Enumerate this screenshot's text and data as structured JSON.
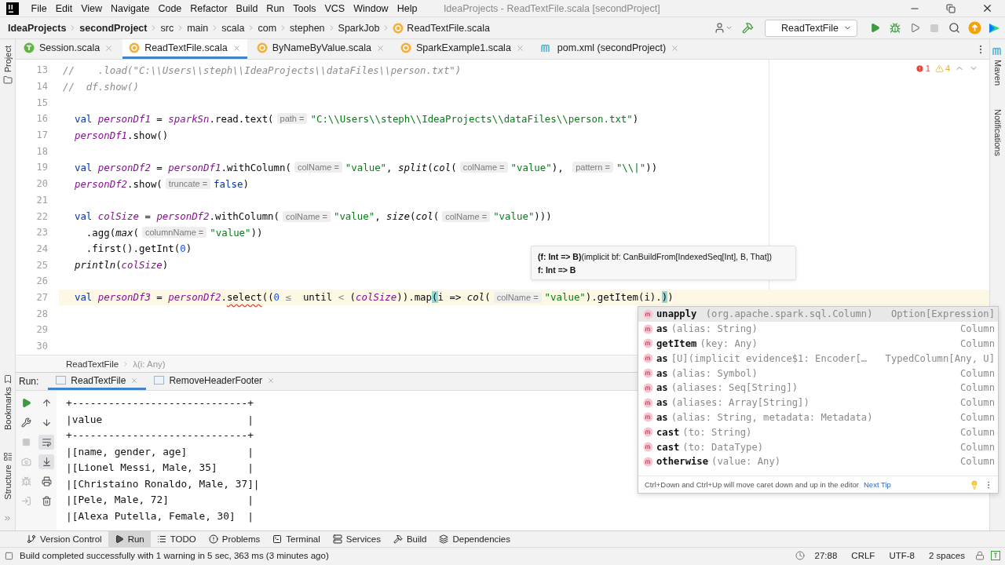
{
  "window": {
    "title": "IdeaProjects - ReadTextFile.scala [secondProject]"
  },
  "menu": [
    "File",
    "Edit",
    "View",
    "Navigate",
    "Code",
    "Refactor",
    "Build",
    "Run",
    "Tools",
    "VCS",
    "Window",
    "Help"
  ],
  "breadcrumb": [
    {
      "label": "IdeaProjects",
      "bold": true
    },
    {
      "label": "secondProject",
      "bold": true
    },
    {
      "label": "src",
      "bold": false
    },
    {
      "label": "main",
      "bold": false
    },
    {
      "label": "scala",
      "bold": false
    },
    {
      "label": "com",
      "bold": false
    },
    {
      "label": "stephen",
      "bold": false
    },
    {
      "label": "SparkJob",
      "bold": false
    },
    {
      "label": "ReadTextFile.scala",
      "bold": false,
      "kind": "object"
    }
  ],
  "toolbar": {
    "run_config": "ReadTextFile"
  },
  "editor_tabs": [
    {
      "label": "Session.scala",
      "kind": "trait",
      "selected": false
    },
    {
      "label": "ReadTextFile.scala",
      "kind": "object",
      "selected": true
    },
    {
      "label": "ByNameByValue.scala",
      "kind": "object",
      "selected": false
    },
    {
      "label": "SparkExample1.scala",
      "kind": "object",
      "selected": false
    },
    {
      "label": "pom.xml (secondProject)",
      "kind": "maven",
      "selected": false
    }
  ],
  "left_stripe": [
    "Project",
    "Bookmarks",
    "Structure"
  ],
  "right_stripe": [
    "Maven",
    "Notifications"
  ],
  "inspections": {
    "errors": "1",
    "warnings": "4"
  },
  "code_lines": [
    {
      "number": "13",
      "current": false,
      "tokens": [
        {
          "kind": "comment",
          "text": "//    .load(\"C:\\\\Users\\\\steph\\\\IdeaProjects\\\\dataFiles\\\\person.txt\")"
        }
      ]
    },
    {
      "number": "14",
      "current": false,
      "tokens": [
        {
          "kind": "comment",
          "text": "//  df.show()"
        }
      ]
    },
    {
      "number": "15",
      "current": false
    },
    {
      "number": "16",
      "current": false,
      "tokens": [
        {
          "kind": "keyword",
          "text": "  val "
        },
        {
          "kind": "var",
          "text": "personDf1"
        },
        {
          "kind": "plain",
          "text": " = "
        },
        {
          "kind": "var",
          "text": "sparkSn"
        },
        {
          "kind": "plain",
          "text": ".read.text("
        },
        {
          "kind": "hint",
          "text": "path ="
        },
        {
          "kind": "string",
          "text": "\"C:\\\\Users\\\\steph\\\\IdeaProjects\\\\dataFiles\\\\person.txt\""
        },
        {
          "kind": "plain",
          "text": ")"
        }
      ]
    },
    {
      "number": "17",
      "current": false,
      "tokens": [
        {
          "kind": "var",
          "text": "  personDf1"
        },
        {
          "kind": "plain",
          "text": ".show()"
        }
      ]
    },
    {
      "number": "18",
      "current": false
    },
    {
      "number": "19",
      "current": false,
      "tokens": [
        {
          "kind": "keyword",
          "text": "  val "
        },
        {
          "kind": "var",
          "text": "personDf2"
        },
        {
          "kind": "plain",
          "text": " = "
        },
        {
          "kind": "var",
          "text": "personDf1"
        },
        {
          "kind": "plain",
          "text": ".withColumn("
        },
        {
          "kind": "hint",
          "text": "colName ="
        },
        {
          "kind": "string",
          "text": "\"value\""
        },
        {
          "kind": "plain",
          "text": ", "
        },
        {
          "kind": "func",
          "text": "split"
        },
        {
          "kind": "plain",
          "text": "("
        },
        {
          "kind": "func",
          "text": "col"
        },
        {
          "kind": "plain",
          "text": "("
        },
        {
          "kind": "hint",
          "text": "colName ="
        },
        {
          "kind": "string",
          "text": "\"value\""
        },
        {
          "kind": "plain",
          "text": "), "
        },
        {
          "kind": "hint",
          "text": "pattern ="
        },
        {
          "kind": "string",
          "text": "\"\\\\|\""
        },
        {
          "kind": "plain",
          "text": "))"
        }
      ]
    },
    {
      "number": "20",
      "current": false,
      "tokens": [
        {
          "kind": "var",
          "text": "  personDf2"
        },
        {
          "kind": "plain",
          "text": ".show("
        },
        {
          "kind": "hint",
          "text": "truncate ="
        },
        {
          "kind": "keyword",
          "text": "false"
        },
        {
          "kind": "plain",
          "text": ")"
        }
      ]
    },
    {
      "number": "21",
      "current": false
    },
    {
      "number": "22",
      "current": false,
      "tokens": [
        {
          "kind": "keyword",
          "text": "  val "
        },
        {
          "kind": "var",
          "text": "colSize"
        },
        {
          "kind": "plain",
          "text": " = "
        },
        {
          "kind": "var",
          "text": "personDf2"
        },
        {
          "kind": "plain",
          "text": ".withColumn("
        },
        {
          "kind": "hint",
          "text": "colName ="
        },
        {
          "kind": "string",
          "text": "\"value\""
        },
        {
          "kind": "plain",
          "text": ", "
        },
        {
          "kind": "func",
          "text": "size"
        },
        {
          "kind": "plain",
          "text": "("
        },
        {
          "kind": "func",
          "text": "col"
        },
        {
          "kind": "plain",
          "text": "("
        },
        {
          "kind": "hint",
          "text": "colName ="
        },
        {
          "kind": "string",
          "text": "\"value\""
        },
        {
          "kind": "plain",
          "text": ")))"
        }
      ]
    },
    {
      "number": "23",
      "current": false,
      "tokens": [
        {
          "kind": "plain",
          "text": "    .agg("
        },
        {
          "kind": "func",
          "text": "max"
        },
        {
          "kind": "plain",
          "text": "("
        },
        {
          "kind": "hint",
          "text": "columnName ="
        },
        {
          "kind": "string",
          "text": "\"value\""
        },
        {
          "kind": "plain",
          "text": "))"
        }
      ]
    },
    {
      "number": "24",
      "current": false,
      "tokens": [
        {
          "kind": "plain",
          "text": "    .first().getInt("
        },
        {
          "kind": "number",
          "text": "0"
        },
        {
          "kind": "plain",
          "text": ")"
        }
      ]
    },
    {
      "number": "25",
      "current": false,
      "tokens": [
        {
          "kind": "func",
          "text": "  println"
        },
        {
          "kind": "plain",
          "text": "("
        },
        {
          "kind": "var",
          "text": "colSize"
        },
        {
          "kind": "plain",
          "text": ")"
        }
      ]
    },
    {
      "number": "26",
      "current": false
    },
    {
      "number": "27",
      "current": true,
      "tokens": [
        {
          "kind": "keyword",
          "text": "  val "
        },
        {
          "kind": "var",
          "text": "personDf3"
        },
        {
          "kind": "plain",
          "text": " = "
        },
        {
          "kind": "var",
          "text": "personDf2"
        },
        {
          "kind": "plain",
          "text": "."
        },
        {
          "kind": "error",
          "text": "select"
        },
        {
          "kind": "plain",
          "text": "(("
        },
        {
          "kind": "number",
          "text": "0"
        },
        {
          "kind": "dim",
          "text": " ≤"
        },
        {
          "kind": "plain",
          "text": "  until "
        },
        {
          "kind": "dim",
          "text": "<"
        },
        {
          "kind": "plain",
          "text": " ("
        },
        {
          "kind": "var",
          "text": "colSize"
        },
        {
          "kind": "plain",
          "text": ")).map"
        },
        {
          "kind": "match",
          "text": "("
        },
        {
          "kind": "plain",
          "text": "i => "
        },
        {
          "kind": "func",
          "text": "col"
        },
        {
          "kind": "plain",
          "text": "("
        },
        {
          "kind": "hint",
          "text": "colName ="
        },
        {
          "kind": "string",
          "text": "\"value\""
        },
        {
          "kind": "plain",
          "text": ").getItem(i)."
        },
        {
          "kind": "match",
          "text": ")"
        },
        {
          "kind": "plain",
          "text": ")"
        }
      ]
    },
    {
      "number": "28",
      "current": false
    },
    {
      "number": "29",
      "current": false
    },
    {
      "number": "30",
      "current": false
    }
  ],
  "param_info": {
    "signature": "**(f: Int => B)**(implicit bf: CanBuildFrom[IndexedSeq[Int], B, That])",
    "current_param": "f: Int => B"
  },
  "completion": {
    "items": [
      {
        "name": "unapply",
        "params": " (org.apache.spark.sql.Column)",
        "type": "Option[Expression]",
        "selected": true
      },
      {
        "name": "as",
        "params": "(alias: String)",
        "type": "Column",
        "selected": false
      },
      {
        "name": "getItem",
        "params": "(key: Any)",
        "type": "Column",
        "selected": false
      },
      {
        "name": "as",
        "params": "[U](implicit evidence$1: Encoder[…",
        "type": "TypedColumn[Any, U]",
        "selected": false
      },
      {
        "name": "as",
        "params": "(alias: Symbol)",
        "type": "Column",
        "selected": false
      },
      {
        "name": "as",
        "params": "(aliases: Seq[String])",
        "type": "Column",
        "selected": false
      },
      {
        "name": "as",
        "params": "(aliases: Array[String])",
        "type": "Column",
        "selected": false
      },
      {
        "name": "as",
        "params": "(alias: String, metadata: Metadata)",
        "type": "Column",
        "selected": false
      },
      {
        "name": "cast",
        "params": "(to: String)",
        "type": "Column",
        "selected": false
      },
      {
        "name": "cast",
        "params": "(to: DataType)",
        "type": "Column",
        "selected": false
      },
      {
        "name": "otherwise",
        "params": "(value: Any)",
        "type": "Column",
        "selected": false
      }
    ],
    "tip": "Ctrl+Down and Ctrl+Up will move caret down and up in the editor",
    "tip_link": "Next Tip"
  },
  "editor_breadcrumb": [
    "ReadTextFile",
    "λ(i: Any)"
  ],
  "run_panel": {
    "label": "Run:",
    "tabs": [
      {
        "label": "ReadTextFile",
        "selected": true
      },
      {
        "label": "RemoveHeaderFooter",
        "selected": false
      }
    ],
    "console_lines": [
      "+-----------------------------+",
      "|value                        |",
      "+-----------------------------+",
      "|[name, gender, age]          |",
      "|[Lionel Messi, Male, 35]     |",
      "|[Christaino Ronaldo, Male, 37]|",
      "|[Pele, Male, 72]             |",
      "|[Alexa Putella, Female, 30]  |"
    ]
  },
  "tool_tabs": [
    {
      "label": "Version Control",
      "kind": "vcs",
      "selected": false
    },
    {
      "label": "Run",
      "kind": "run",
      "selected": true
    },
    {
      "label": "TODO",
      "kind": "todo",
      "selected": false
    },
    {
      "label": "Problems",
      "kind": "problems",
      "selected": false
    },
    {
      "label": "Terminal",
      "kind": "terminal",
      "selected": false
    },
    {
      "label": "Services",
      "kind": "services",
      "selected": false
    },
    {
      "label": "Build",
      "kind": "build",
      "selected": false
    },
    {
      "label": "Dependencies",
      "kind": "dependencies",
      "selected": false
    }
  ],
  "status": {
    "message": "Build completed successfully with 1 warning in 5 sec, 363 ms (3 minutes ago)",
    "position": "27:88",
    "line_ending": "CRLF",
    "encoding": "UTF-8",
    "indent": "2 spaces"
  }
}
